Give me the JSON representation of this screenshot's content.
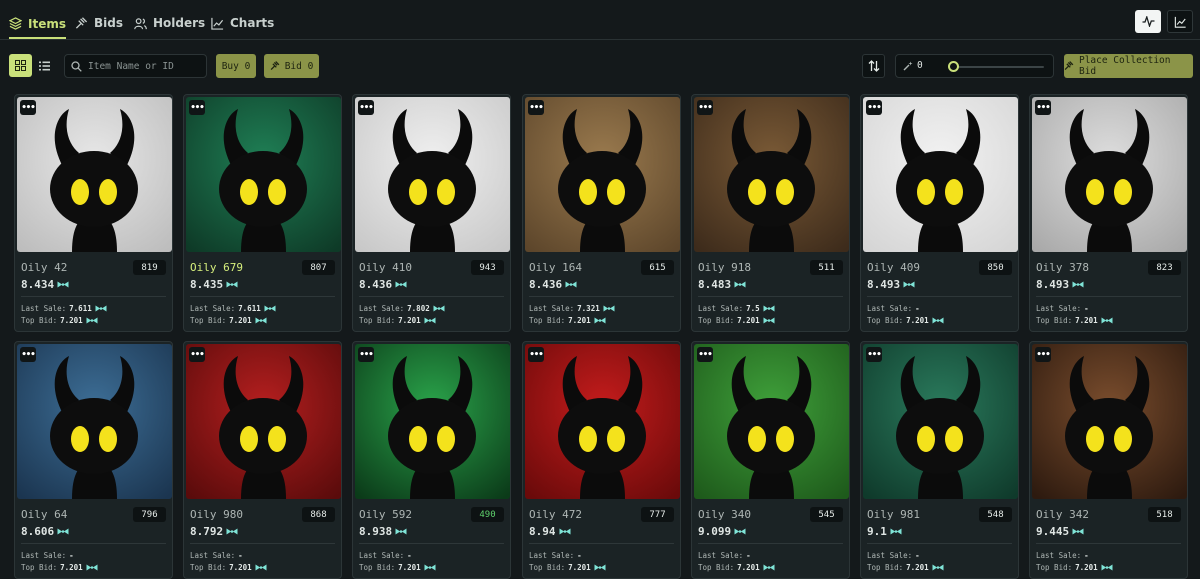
{
  "tabs": [
    {
      "label": "Items",
      "icon": "layers-icon",
      "active": true
    },
    {
      "label": "Bids",
      "icon": "gavel-icon",
      "active": false
    },
    {
      "label": "Holders",
      "icon": "users-icon",
      "active": false
    },
    {
      "label": "Charts",
      "icon": "line-chart-icon",
      "active": false
    }
  ],
  "toolbar": {
    "search_placeholder": "Item Name or ID",
    "buy_label": "Buy 0",
    "bid_label": "Bid 0",
    "slider_value": "0",
    "place_bid_label": "Place Collection Bid"
  },
  "labels": {
    "last_sale": "Last Sale:",
    "top_bid": "Top Bid:",
    "more": "•••"
  },
  "colors": {
    "accent": "#c9e07a",
    "olive_button": "#8b9448",
    "background": "#14191b",
    "card": "#1b2325",
    "rank_green": "#5fd16d",
    "token": "#7fe3d6"
  },
  "items": [
    {
      "name": "Oily 42",
      "rank": "819",
      "price": "8.434",
      "last_sale": "7.611",
      "top_bid": "7.201",
      "bg": "#e7e7e7",
      "bg2": "#bdbdbd"
    },
    {
      "name": "Oily 679",
      "rank": "807",
      "price": "8.435",
      "last_sale": "7.611",
      "top_bid": "7.201",
      "bg": "#1f7f55",
      "bg2": "#0e3a27",
      "highlight": true
    },
    {
      "name": "Oily 410",
      "rank": "943",
      "price": "8.436",
      "last_sale": "7.802",
      "top_bid": "7.201",
      "bg": "#efefef",
      "bg2": "#c8c8c8"
    },
    {
      "name": "Oily 164",
      "rank": "615",
      "price": "8.436",
      "last_sale": "7.321",
      "top_bid": "7.201",
      "bg": "#9a7a4e",
      "bg2": "#5d462b"
    },
    {
      "name": "Oily 918",
      "rank": "511",
      "price": "8.483",
      "last_sale": "7.5",
      "top_bid": "7.201",
      "bg": "#7a5a36",
      "bg2": "#3d2b1b"
    },
    {
      "name": "Oily 409",
      "rank": "850",
      "price": "8.493",
      "last_sale": "-",
      "top_bid": "7.201",
      "bg": "#f2f2f2",
      "bg2": "#d5d5d5"
    },
    {
      "name": "Oily 378",
      "rank": "823",
      "price": "8.493",
      "last_sale": "-",
      "top_bid": "7.201",
      "bg": "#dddddd",
      "bg2": "#a9a9a9"
    },
    {
      "name": "Oily 64",
      "rank": "796",
      "price": "8.606",
      "last_sale": "-",
      "top_bid": "7.201",
      "bg": "#3d6e96",
      "bg2": "#1b3550"
    },
    {
      "name": "Oily 980",
      "rank": "868",
      "price": "8.792",
      "last_sale": "-",
      "top_bid": "7.201",
      "bg": "#b51f1f",
      "bg2": "#5a0b0b"
    },
    {
      "name": "Oily 592",
      "rank": "490",
      "price": "8.938",
      "last_sale": "-",
      "top_bid": "7.201",
      "bg": "#2aa34a",
      "bg2": "#0b3b19",
      "rank_green": true
    },
    {
      "name": "Oily 472",
      "rank": "777",
      "price": "8.94",
      "last_sale": "-",
      "top_bid": "7.201",
      "bg": "#c41c1c",
      "bg2": "#6a0a0a"
    },
    {
      "name": "Oily 340",
      "rank": "545",
      "price": "9.099",
      "last_sale": "-",
      "top_bid": "7.201",
      "bg": "#3fa03a",
      "bg2": "#1e5a1b"
    },
    {
      "name": "Oily 981",
      "rank": "548",
      "price": "9.1",
      "last_sale": "-",
      "top_bid": "7.201",
      "bg": "#2a7a5c",
      "bg2": "#0f3a2b"
    },
    {
      "name": "Oily 342",
      "rank": "518",
      "price": "9.445",
      "last_sale": "-",
      "top_bid": "7.201",
      "bg": "#7a4d2d",
      "bg2": "#2d1a0f"
    }
  ]
}
